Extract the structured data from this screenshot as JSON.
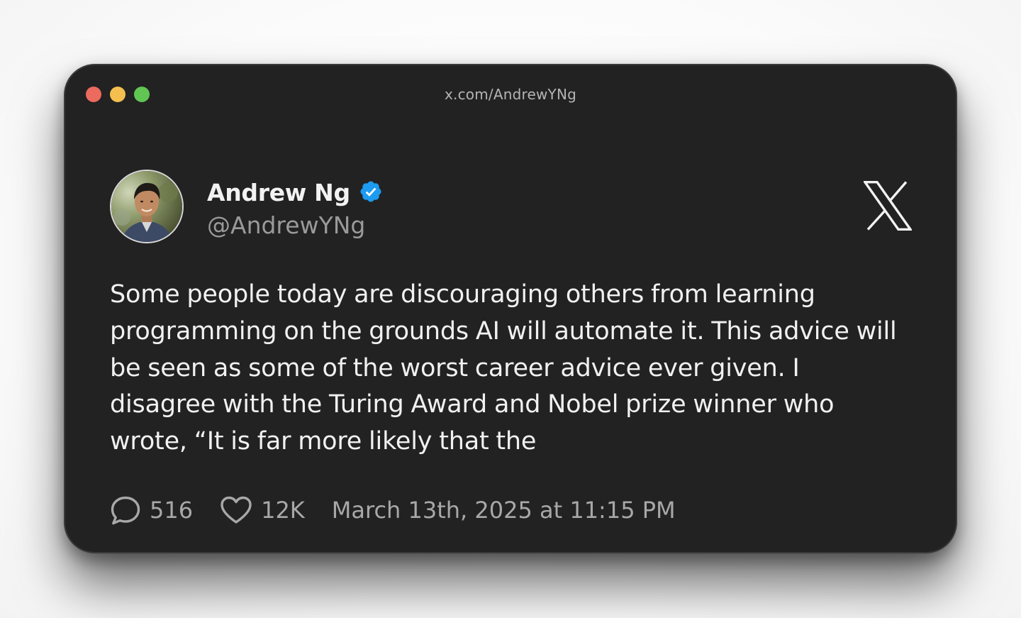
{
  "window": {
    "url": "x.com/AndrewYNg",
    "traffic_lights": {
      "close": "#ed6a5e",
      "minimize": "#f5bf4f",
      "maximize": "#61c554"
    }
  },
  "tweet": {
    "author_name": "Andrew Ng",
    "handle": "@AndrewYNg",
    "verified": true,
    "text": "Some people today are discouraging others from learning programming on the grounds AI will automate it. This advice will be seen as some of the worst career advice ever given. I disagree with the Turing Award and Nobel prize winner who wrote, “It is far more likely that the",
    "replies": "516",
    "likes": "12K",
    "timestamp": "March 13th, 2025 at 11:15 PM"
  },
  "icons": {
    "verified": "verified-badge-icon",
    "brand": "x-logo-icon",
    "reply": "speech-bubble-icon",
    "like": "heart-icon"
  },
  "colors": {
    "window_bg": "#222222",
    "verified_blue": "#1d9bf0",
    "text_primary": "#f1f1f1",
    "text_secondary": "#9a9a9a"
  }
}
